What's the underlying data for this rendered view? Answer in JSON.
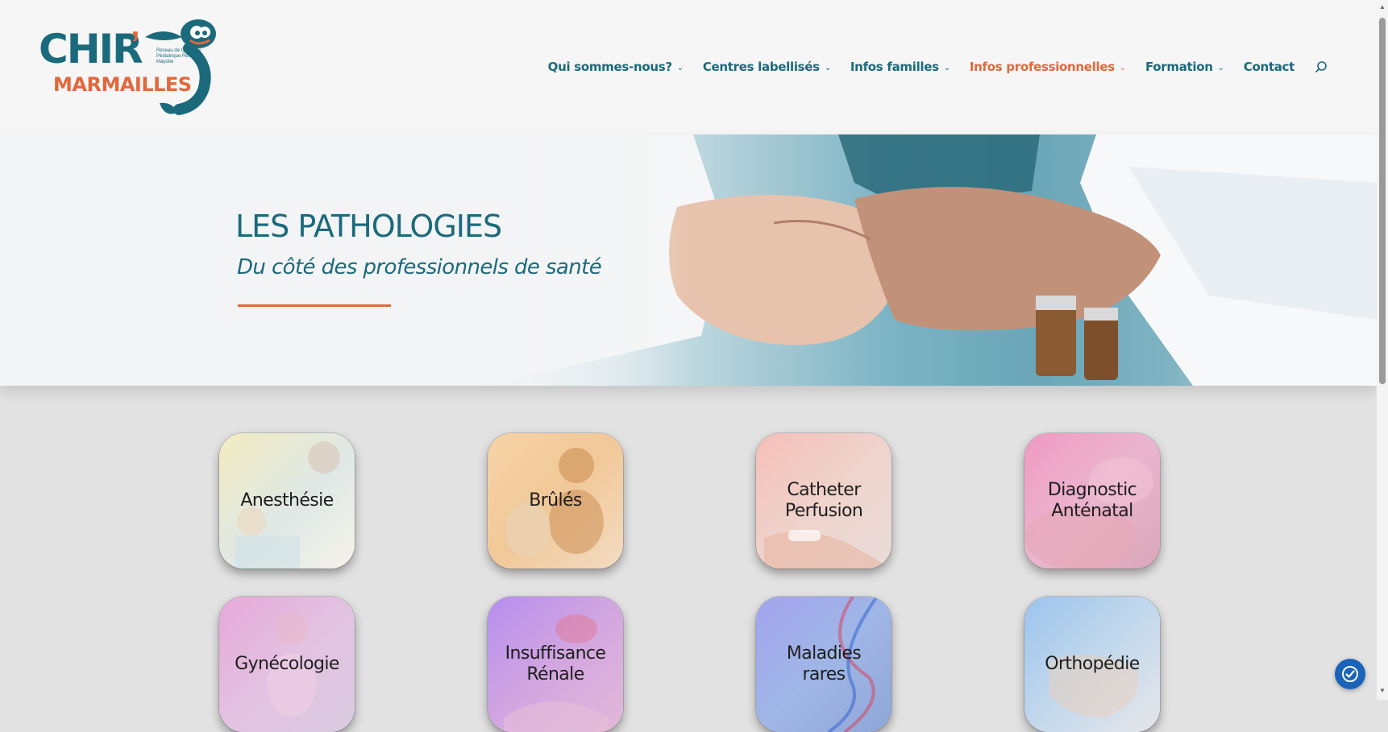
{
  "logo": {
    "chir": "CHIR",
    "apostrophe": "’",
    "marmailles": "MARMAILLES",
    "tagline": "Réseau de Chirurgie Pédiatrique Réunion - Mayotte"
  },
  "nav": {
    "items": [
      {
        "label": "Qui sommes-nous?",
        "dropdown": true,
        "active": false
      },
      {
        "label": "Centres labellisés",
        "dropdown": true,
        "active": false
      },
      {
        "label": "Infos familles",
        "dropdown": true,
        "active": false
      },
      {
        "label": "Infos professionnelles",
        "dropdown": true,
        "active": true
      },
      {
        "label": "Formation",
        "dropdown": true,
        "active": false
      },
      {
        "label": "Contact",
        "dropdown": false,
        "active": false
      }
    ],
    "caret": "⌄",
    "search_icon": "search-icon"
  },
  "hero": {
    "title": "LES PATHOLOGIES",
    "subtitle": "Du côté des professionnels de santé"
  },
  "tiles": [
    {
      "line1": "Anesthésie",
      "line2": ""
    },
    {
      "line1": "Brûlés",
      "line2": ""
    },
    {
      "line1": "Catheter",
      "line2": "Perfusion"
    },
    {
      "line1": "Diagnostic",
      "line2": "Anténatal"
    },
    {
      "line1": "Gynécologie",
      "line2": ""
    },
    {
      "line1": "Insuffisance",
      "line2": "Rénale"
    },
    {
      "line1": "Maladies",
      "line2": "rares"
    },
    {
      "line1": "Orthopédie",
      "line2": ""
    }
  ],
  "colors": {
    "brand_teal": "#1b6a7c",
    "brand_orange": "#e2683c",
    "page_bg": "#e2e2e2",
    "widget_blue": "#1a63b8"
  },
  "widget": {
    "icon": "accessibility-check-icon"
  }
}
